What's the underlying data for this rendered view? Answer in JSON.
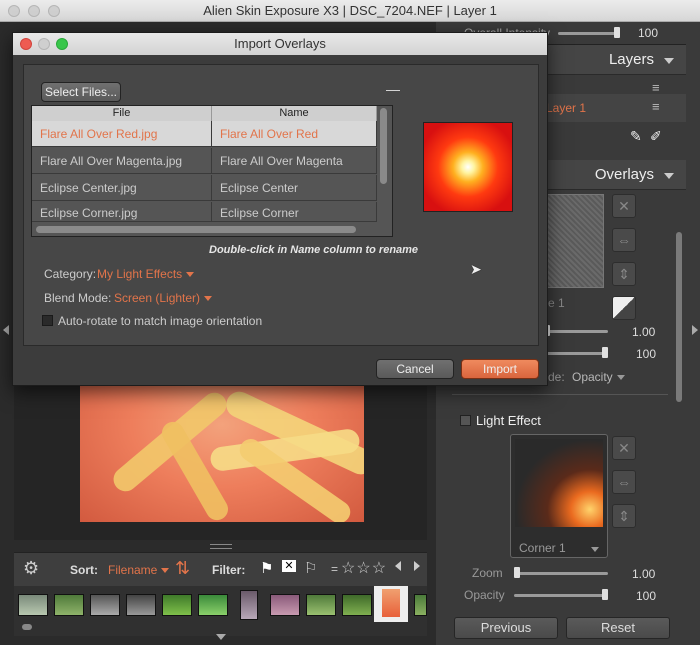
{
  "app": {
    "title": "Alien Skin Exposure X3 | DSC_7204.NEF | Layer 1"
  },
  "right_panel": {
    "overall_intensity_label": "Overall Intensity",
    "overall_intensity_value": "100",
    "overall_intensity_fraction": 1.0,
    "layers": {
      "title": "Layers",
      "layer_name": "Layer 1"
    },
    "overlays": {
      "title": "Overlays",
      "frame_name": "e 1",
      "value_1": "1.00",
      "value_2": "100",
      "blend_label": "de:",
      "blend_value": "Opacity"
    },
    "light_effect": {
      "title": "Light Effect",
      "preset_name": "Corner 1",
      "zoom_label": "Zoom",
      "zoom_value": "1.00",
      "opacity_label": "Opacity",
      "opacity_value": "100"
    },
    "previous_label": "Previous",
    "reset_label": "Reset"
  },
  "filmstrip": {
    "sort_label": "Sort:",
    "sort_value": "Filename",
    "filter_label": "Filter:",
    "equal_sign": "="
  },
  "dialog": {
    "title": "Import Overlays",
    "select_files_label": "Select Files...",
    "collapse_glyph": "—",
    "table": {
      "headers": [
        "File",
        "Name"
      ],
      "rows": [
        {
          "file": "Flare All Over Red.jpg",
          "name": "Flare All Over Red",
          "selected": true
        },
        {
          "file": "Flare All Over Magenta.jpg",
          "name": "Flare All Over Magenta",
          "selected": false
        },
        {
          "file": "Eclipse Center.jpg",
          "name": "Eclipse Center",
          "selected": false
        },
        {
          "file": "Eclipse Corner.jpg",
          "name": "Eclipse Corner",
          "selected": false
        }
      ]
    },
    "hint": "Double-click in Name column to rename",
    "category_label": "Category:",
    "category_value": "My Light Effects",
    "blend_label": "Blend Mode:",
    "blend_value": "Screen (Lighter)",
    "autorotate_label": "Auto-rotate to match image orientation",
    "cancel_label": "Cancel",
    "import_label": "Import"
  },
  "colors": {
    "accent": "#e2744a",
    "panel": "#3a3a3a"
  }
}
